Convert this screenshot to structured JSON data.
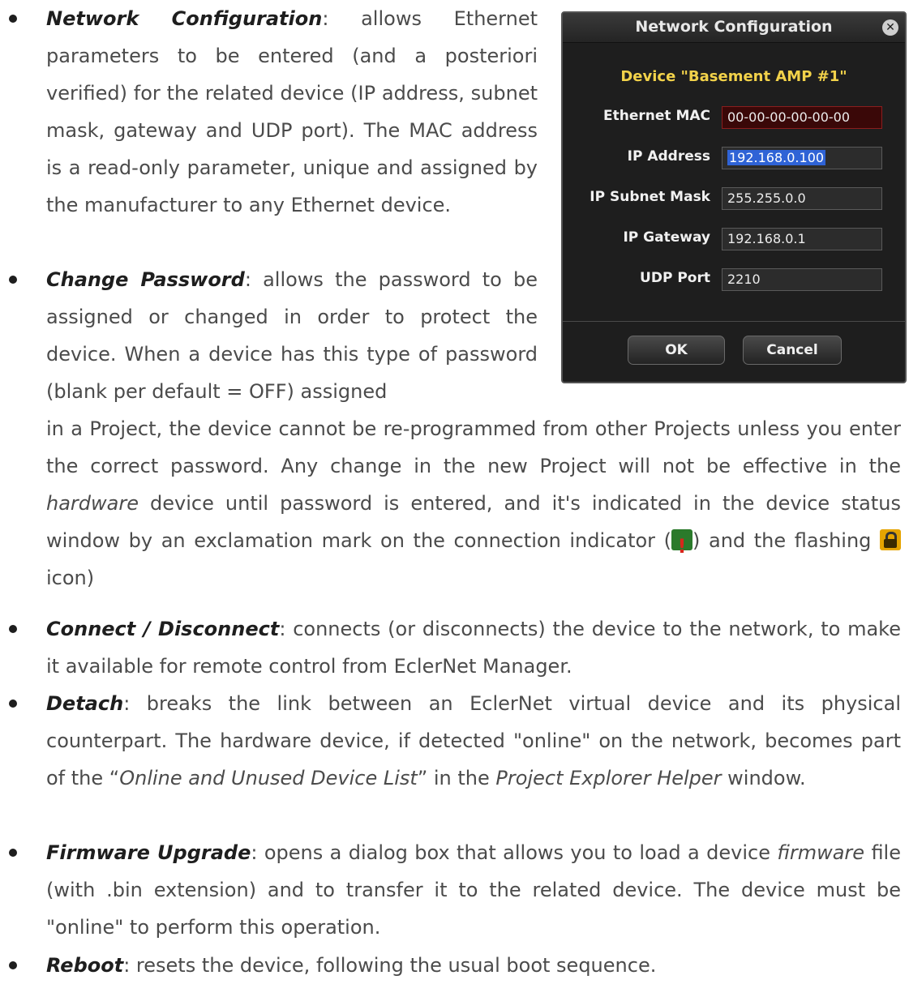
{
  "items": [
    {
      "term": "Network Configuration",
      "text": ": allows Ethernet parameters to be entered (and a posteriori verified) for the related device (IP address, subnet mask, gateway and UDP port). The MAC address is a read-only parameter, unique and assigned by the manufacturer to any Ethernet device."
    },
    {
      "term": "Change Password",
      "text_a": ": allows the password to be assigned or changed in order to protect the device. When a device has this type of password (blank per default = OFF) assigned",
      "text_b": "in a Project, the device cannot be re-programmed from other Projects unless you enter the correct password. Any change in the new Project will not be effective in the ",
      "text_b_italic": "hardware",
      "text_c": " device until password is entered, and it's indicated in the device status window by an exclamation mark on the connection indicator (",
      "text_d": ") and the flashing ",
      "text_e": " icon)"
    },
    {
      "term": "Connect / Disconnect",
      "text": ": connects (or disconnects) the device to the network, to make it available for remote control from EclerNet Manager."
    },
    {
      "term": "Detach",
      "text_a": ": breaks the link between an EclerNet virtual device and its physical counterpart. The hardware device, if detected \"online\" on the network, becomes part of the “",
      "text_italic1": "Online and Unused Device List",
      "text_b": "” in the ",
      "text_italic2": "Project Explorer Helper",
      "text_c": " window."
    },
    {
      "term": "Firmware Upgrade",
      "text_a": ": opens a dialog box that allows you to load a device ",
      "text_italic": "firmware",
      "text_b": " file (with .bin extension) and to transfer it to the related device. The device must be \"online\" to perform this operation."
    },
    {
      "term": "Reboot",
      "text": ": resets the device, following the usual boot sequence."
    }
  ],
  "dialog": {
    "title": "Network Configuration",
    "device_label": "Device \"Basement AMP #1\"",
    "fields": [
      {
        "label": "Ethernet MAC",
        "value": "00-00-00-00-00-00"
      },
      {
        "label": "IP Address",
        "value": "192.168.0.100"
      },
      {
        "label": "IP Subnet Mask",
        "value": "255.255.0.0"
      },
      {
        "label": "IP Gateway",
        "value": "192.168.0.1"
      },
      {
        "label": "UDP Port",
        "value": "2210"
      }
    ],
    "ok_label": "OK",
    "cancel_label": "Cancel",
    "close_glyph": "✕"
  }
}
